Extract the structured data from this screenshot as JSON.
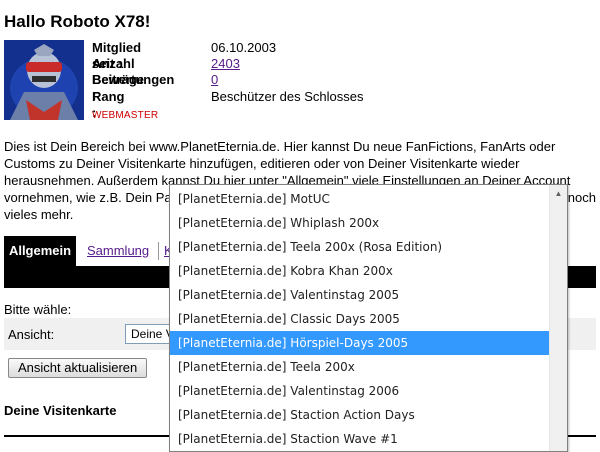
{
  "page": {
    "title": "Hallo Roboto X78!"
  },
  "profile": {
    "rows": [
      {
        "label": "Mitglied seit :",
        "value": "06.10.2003",
        "link": false
      },
      {
        "label": "Anzahl Beiträge :",
        "value": "2403",
        "link": true
      },
      {
        "label": "Bewertungen :",
        "value": "0",
        "link": true
      },
      {
        "label": "Rang :",
        "value": "Beschützer des Schlosses",
        "link": false
      }
    ],
    "role": "WEBMASTER"
  },
  "intro": {
    "line1": "Dies ist Dein Bereich bei www.PlanetEternia.de. Hier kannst Du neue FanFictions, FanArts oder",
    "line2": "Customs zu Deiner Visitenkarte hinzufügen, editieren oder von Deiner Visitenkarte wieder",
    "line3": "herausnehmen. Außerdem kannst Du hier unter \"Allgemein\" viele Einstellungen an Deiner Account",
    "line4a": "vornehmen, wie z.B. Dein Pa",
    "line4b": "noch",
    "line5": "vieles mehr."
  },
  "tabs": {
    "active": "Allgemein",
    "second": "Sammlung",
    "third": "K"
  },
  "form": {
    "choose_label": "Bitte wähle:",
    "ansicht_label": "Ansicht:",
    "select_value": "Deine V",
    "update_button": "Ansicht aktualisieren"
  },
  "card": {
    "title": "Deine Visitenkarte"
  },
  "dropdown": {
    "items": [
      "[PlanetEternia.de] MotUC",
      "[PlanetEternia.de] Whiplash 200x",
      "[PlanetEternia.de] Teela 200x (Rosa Edition)",
      "[PlanetEternia.de] Kobra Khan 200x",
      "[PlanetEternia.de] Valentinstag 2005",
      "[PlanetEternia.de] Classic Days 2005",
      "[PlanetEternia.de] Hörspiel-Days 2005",
      "[PlanetEternia.de] Teela 200x",
      "[PlanetEternia.de] Valentinstag 2006",
      "[PlanetEternia.de] Staction Action Days",
      "[PlanetEternia.de] Staction Wave #1"
    ],
    "selected_index": 6,
    "scroll_up_glyph": "▲"
  },
  "colors": {
    "selection": "#3399ff",
    "link": "#551a8b",
    "role": "#cc0000",
    "tab_bar": "#000000"
  }
}
